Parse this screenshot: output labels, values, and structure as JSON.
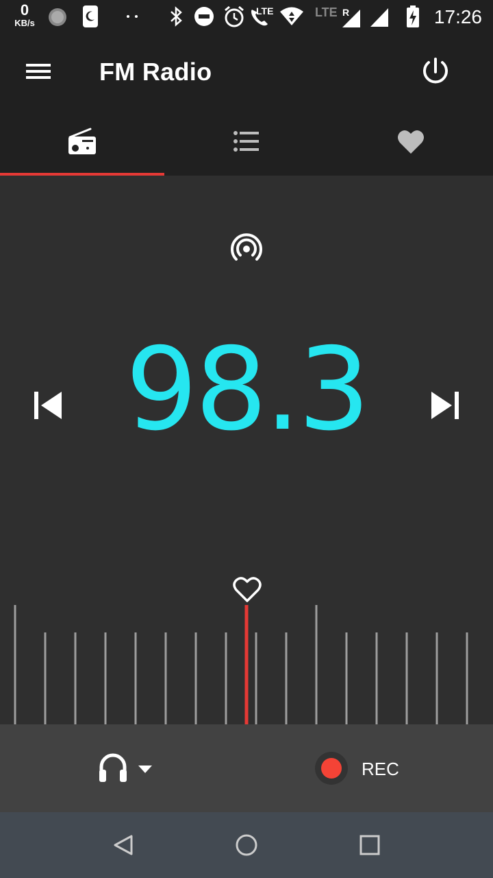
{
  "status_bar": {
    "net_speed_value": "0",
    "net_speed_unit": "KB/s",
    "network_label": "LTE",
    "network_label_2": "LTE",
    "roaming_label": "R",
    "time": "17:26"
  },
  "app_bar": {
    "title": "FM Radio",
    "menu_icon": "hamburger-menu-icon",
    "power_icon": "power-icon"
  },
  "tabs": [
    {
      "name": "radio",
      "icon": "radio-icon",
      "selected": true
    },
    {
      "name": "stations",
      "icon": "list-icon",
      "selected": false
    },
    {
      "name": "favorites",
      "icon": "heart-icon",
      "selected": false
    }
  ],
  "tuner": {
    "frequency": "98.3",
    "favorite": false,
    "rds_icon": "broadcast-icon"
  },
  "bottom": {
    "audio_output_icon": "headphones-icon",
    "rec_label": "REC"
  },
  "colors": {
    "accent": "#e53935",
    "frequency": "#26e6f0",
    "tick": "#9e9e9e",
    "icon_active": "#ffffff",
    "icon_inactive": "#bdbdbd"
  }
}
